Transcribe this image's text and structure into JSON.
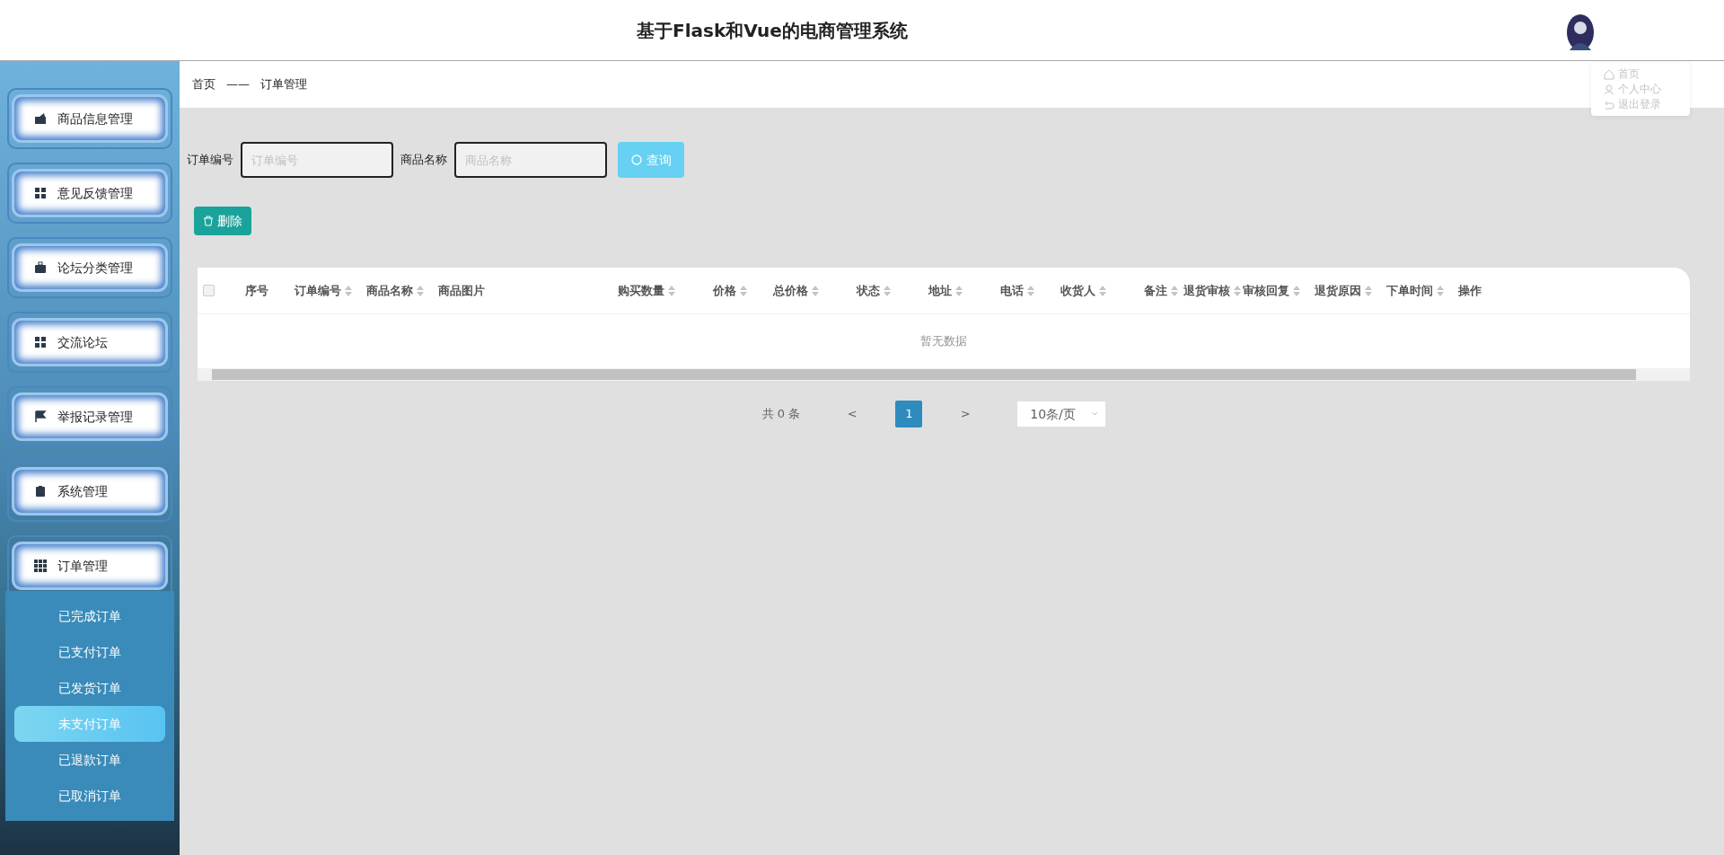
{
  "header": {
    "title": "基于Flask和Vue的电商管理系统"
  },
  "user_menu": [
    {
      "label": "首页"
    },
    {
      "label": "个人中心"
    },
    {
      "label": "退出登录"
    }
  ],
  "sidebar": {
    "items": [
      {
        "label": "商品信息管理"
      },
      {
        "label": "意见反馈管理"
      },
      {
        "label": "论坛分类管理"
      },
      {
        "label": "交流论坛"
      },
      {
        "label": "举报记录管理"
      },
      {
        "label": "系统管理"
      },
      {
        "label": "订单管理",
        "children": [
          {
            "label": "已完成订单",
            "selected": false
          },
          {
            "label": "已支付订单",
            "selected": false
          },
          {
            "label": "已发货订单",
            "selected": false
          },
          {
            "label": "未支付订单",
            "selected": true
          },
          {
            "label": "已退款订单",
            "selected": false
          },
          {
            "label": "已取消订单",
            "selected": false
          }
        ]
      }
    ]
  },
  "breadcrumb": [
    {
      "label": "首页"
    },
    {
      "label": "——"
    },
    {
      "label": "订单管理"
    }
  ],
  "search": {
    "fields": [
      {
        "label": "订单编号",
        "placeholder": "订单编号"
      },
      {
        "label": "商品名称",
        "placeholder": "商品名称"
      }
    ],
    "button": "查询"
  },
  "delete_button": "删除",
  "table": {
    "select_all": {
      "checked": false
    },
    "columns": [
      {
        "label": "序号",
        "sortable": false
      },
      {
        "label": "订单编号",
        "sortable": true
      },
      {
        "label": "商品名称",
        "sortable": true
      },
      {
        "label": "商品图片",
        "sortable": false
      },
      {
        "label": "购买数量",
        "sortable": true
      },
      {
        "label": "价格",
        "sortable": true
      },
      {
        "label": "总价格",
        "sortable": true
      },
      {
        "label": "状态",
        "sortable": true
      },
      {
        "label": "地址",
        "sortable": true
      },
      {
        "label": "电话",
        "sortable": true
      },
      {
        "label": "收货人",
        "sortable": true
      },
      {
        "label": "备注",
        "sortable": true
      },
      {
        "label": "退货审核",
        "sortable": true
      },
      {
        "label": "审核回复",
        "sortable": true
      },
      {
        "label": "退货原因",
        "sortable": true
      },
      {
        "label": "下单时间",
        "sortable": true
      },
      {
        "label": "操作",
        "sortable": false
      }
    ],
    "empty_text": "暂无数据"
  },
  "pagination": {
    "total": "共 0 条",
    "prev": "<",
    "pages": [
      {
        "label": "1",
        "selected": true
      }
    ],
    "next": ">",
    "page_size": "10条/页"
  }
}
